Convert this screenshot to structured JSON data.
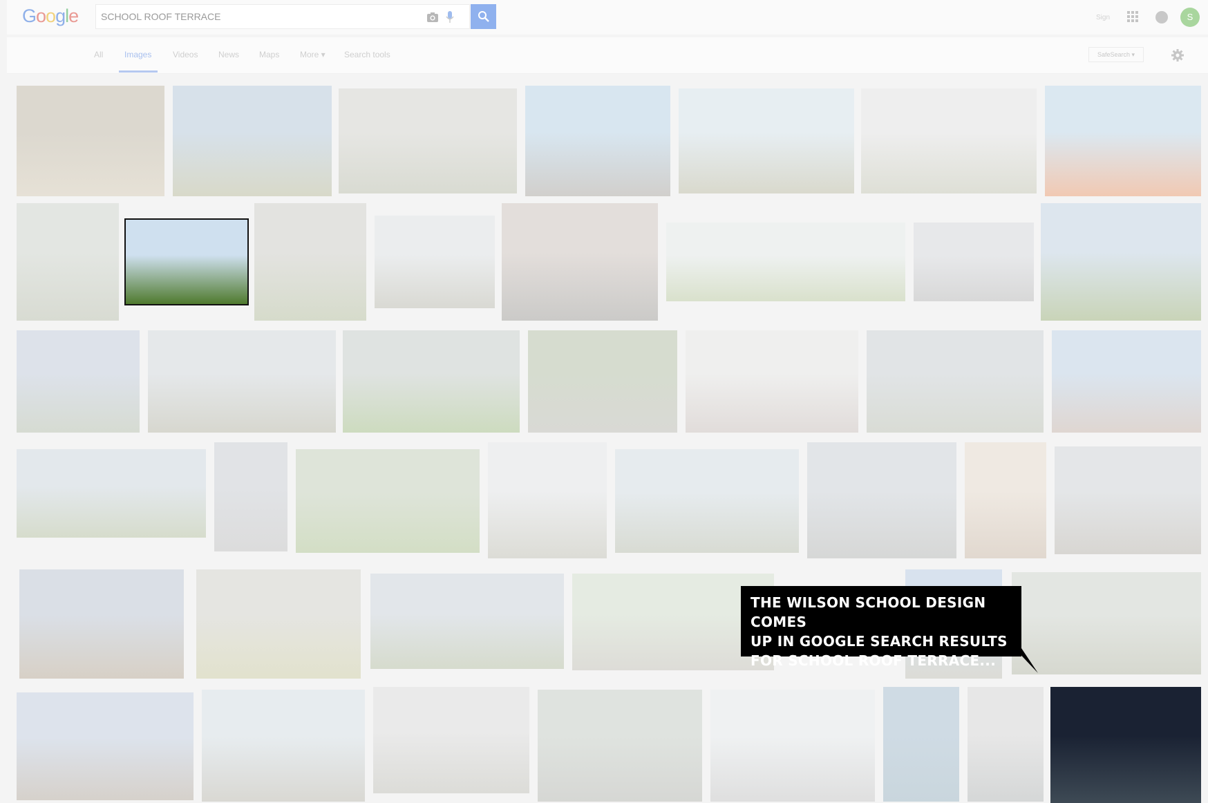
{
  "search": {
    "query": "SCHOOL ROOF TERRACE"
  },
  "logo": {
    "text": "Google"
  },
  "header": {
    "signin_label": "Sign",
    "avatar_initial": "S"
  },
  "tabs": [
    {
      "label": "All",
      "active": false
    },
    {
      "label": "Images",
      "active": true
    },
    {
      "label": "Videos",
      "active": false
    },
    {
      "label": "News",
      "active": false
    },
    {
      "label": "Maps",
      "active": false
    },
    {
      "label": "More ▾",
      "active": false
    },
    {
      "label": "Search tools",
      "active": false
    }
  ],
  "safesearch_label": "SafeSearch ▾",
  "callout": {
    "lines": [
      "THE WILSON SCHOOL DESIGN COMES",
      "UP IN GOOGLE SEARCH RESULTS",
      "FOR SCHOOL ROOF TERRACE..."
    ]
  },
  "colors": {
    "accent": "#4285f4",
    "callout_bg": "#000000",
    "callout_text": "#ffffff",
    "highlight_border": "#111111"
  },
  "results": [
    {
      "id": "r1-1",
      "top": "#dcd8cf",
      "bot": "#e6e1d6",
      "highlighted": false
    },
    {
      "id": "r1-2",
      "top": "#d7e1ea",
      "bot": "#d8d9c9",
      "highlighted": false
    },
    {
      "id": "r1-3",
      "top": "#e6e6e3",
      "bot": "#d9dbd2",
      "highlighted": false
    },
    {
      "id": "r1-4",
      "top": "#d8e6f0",
      "bot": "#d1cfcc",
      "highlighted": false
    },
    {
      "id": "r1-5",
      "top": "#e7eef2",
      "bot": "#d9d9cd",
      "highlighted": false
    },
    {
      "id": "r1-6",
      "top": "#eeeeee",
      "bot": "#dedfd6",
      "highlighted": false
    },
    {
      "id": "r1-7",
      "top": "#dbe8f1",
      "bot": "#f1c9b3",
      "highlighted": false
    },
    {
      "id": "r2-1",
      "top": "#e3e6e2",
      "bot": "#d8dbd2",
      "highlighted": false
    },
    {
      "id": "r2-2",
      "top": "#cfe0ef",
      "bot": "#4f7a2e",
      "highlighted": true
    },
    {
      "id": "r2-3",
      "top": "#e3e3e0",
      "bot": "#d6dbcb",
      "highlighted": false
    },
    {
      "id": "r2-4",
      "top": "#ebedee",
      "bot": "#d9d9d3",
      "highlighted": false
    },
    {
      "id": "r2-5",
      "top": "#e3dedb",
      "bot": "#cbcac8",
      "highlighted": false
    },
    {
      "id": "r2-6",
      "top": "#eef1f0",
      "bot": "#d9e1cc",
      "highlighted": false
    },
    {
      "id": "r2-7",
      "top": "#e7e8ea",
      "bot": "#d8d8d8",
      "highlighted": false
    },
    {
      "id": "r2-8",
      "top": "#dde6ee",
      "bot": "#c9d4b8",
      "highlighted": false
    },
    {
      "id": "r3-1",
      "top": "#dde2ea",
      "bot": "#d6dbd2",
      "highlighted": false
    },
    {
      "id": "r3-2",
      "top": "#e5e8ea",
      "bot": "#d7d7cf",
      "highlighted": false
    },
    {
      "id": "r3-3",
      "top": "#dfe3e1",
      "bot": "#cddbbf",
      "highlighted": false
    },
    {
      "id": "r3-4",
      "top": "#d6dccf",
      "bot": "#d9d9d5",
      "highlighted": false
    },
    {
      "id": "r3-5",
      "top": "#efefee",
      "bot": "#e1dcda",
      "highlighted": false
    },
    {
      "id": "r3-6",
      "top": "#e1e4e6",
      "bot": "#d9dcd5",
      "highlighted": false
    },
    {
      "id": "r3-7",
      "top": "#dbe5ef",
      "bot": "#dfd6d1",
      "highlighted": false
    },
    {
      "id": "r4-1",
      "top": "#e3e8ec",
      "bot": "#d6dccc",
      "highlighted": false
    },
    {
      "id": "r4-2",
      "top": "#e1e3e6",
      "bot": "#dcdcdc",
      "highlighted": false
    },
    {
      "id": "r4-3",
      "top": "#dee4d9",
      "bot": "#d3dec5",
      "highlighted": false
    },
    {
      "id": "r4-4",
      "top": "#eeeff0",
      "bot": "#dcdcd6",
      "highlighted": false
    },
    {
      "id": "r4-5",
      "top": "#e6ebee",
      "bot": "#d8dbd3",
      "highlighted": false
    },
    {
      "id": "r4-6",
      "top": "#e2e5e8",
      "bot": "#d6d7d6",
      "highlighted": false
    },
    {
      "id": "r4-7",
      "top": "#efe9e2",
      "bot": "#e1d8cf",
      "highlighted": false
    },
    {
      "id": "r4-8",
      "top": "#e4e6e8",
      "bot": "#d8d6d2",
      "highlighted": false
    },
    {
      "id": "r5-1",
      "top": "#dadfe6",
      "bot": "#d7d0c6",
      "highlighted": false
    },
    {
      "id": "r5-2",
      "top": "#e5e5e1",
      "bot": "#e2e2cd",
      "highlighted": false
    },
    {
      "id": "r5-3",
      "top": "#e2e6ea",
      "bot": "#d6dbcd",
      "highlighted": false
    },
    {
      "id": "r5-4",
      "top": "#e5ebe2",
      "bot": "#dddcd7",
      "highlighted": false
    },
    {
      "id": "r5-5",
      "top": "#d8e2ee",
      "bot": "#dcdcd6",
      "highlighted": false
    },
    {
      "id": "r5-6",
      "top": "#e3e6e2",
      "bot": "#d6d8cf",
      "highlighted": false
    },
    {
      "id": "r6-1",
      "top": "#dde3ec",
      "bot": "#d6d1cb",
      "highlighted": false
    },
    {
      "id": "r6-2",
      "top": "#e7ecef",
      "bot": "#d9d8d3",
      "highlighted": false
    },
    {
      "id": "r6-3",
      "top": "#eaeaea",
      "bot": "#dcdcd8",
      "highlighted": false
    },
    {
      "id": "r6-4",
      "top": "#dfe3df",
      "bot": "#d6d7d4",
      "highlighted": false
    },
    {
      "id": "r6-5",
      "top": "#eff1f2",
      "bot": "#dfdfdf",
      "highlighted": false
    },
    {
      "id": "r6-6",
      "top": "#cfdbe4",
      "bot": "#c9d6dd",
      "highlighted": false
    },
    {
      "id": "r6-7",
      "top": "#e7e7e7",
      "bot": "#d5d7d7",
      "highlighted": false
    },
    {
      "id": "r6-8",
      "top": "#1a2233",
      "bot": "#3e4a55",
      "highlighted": false
    }
  ]
}
